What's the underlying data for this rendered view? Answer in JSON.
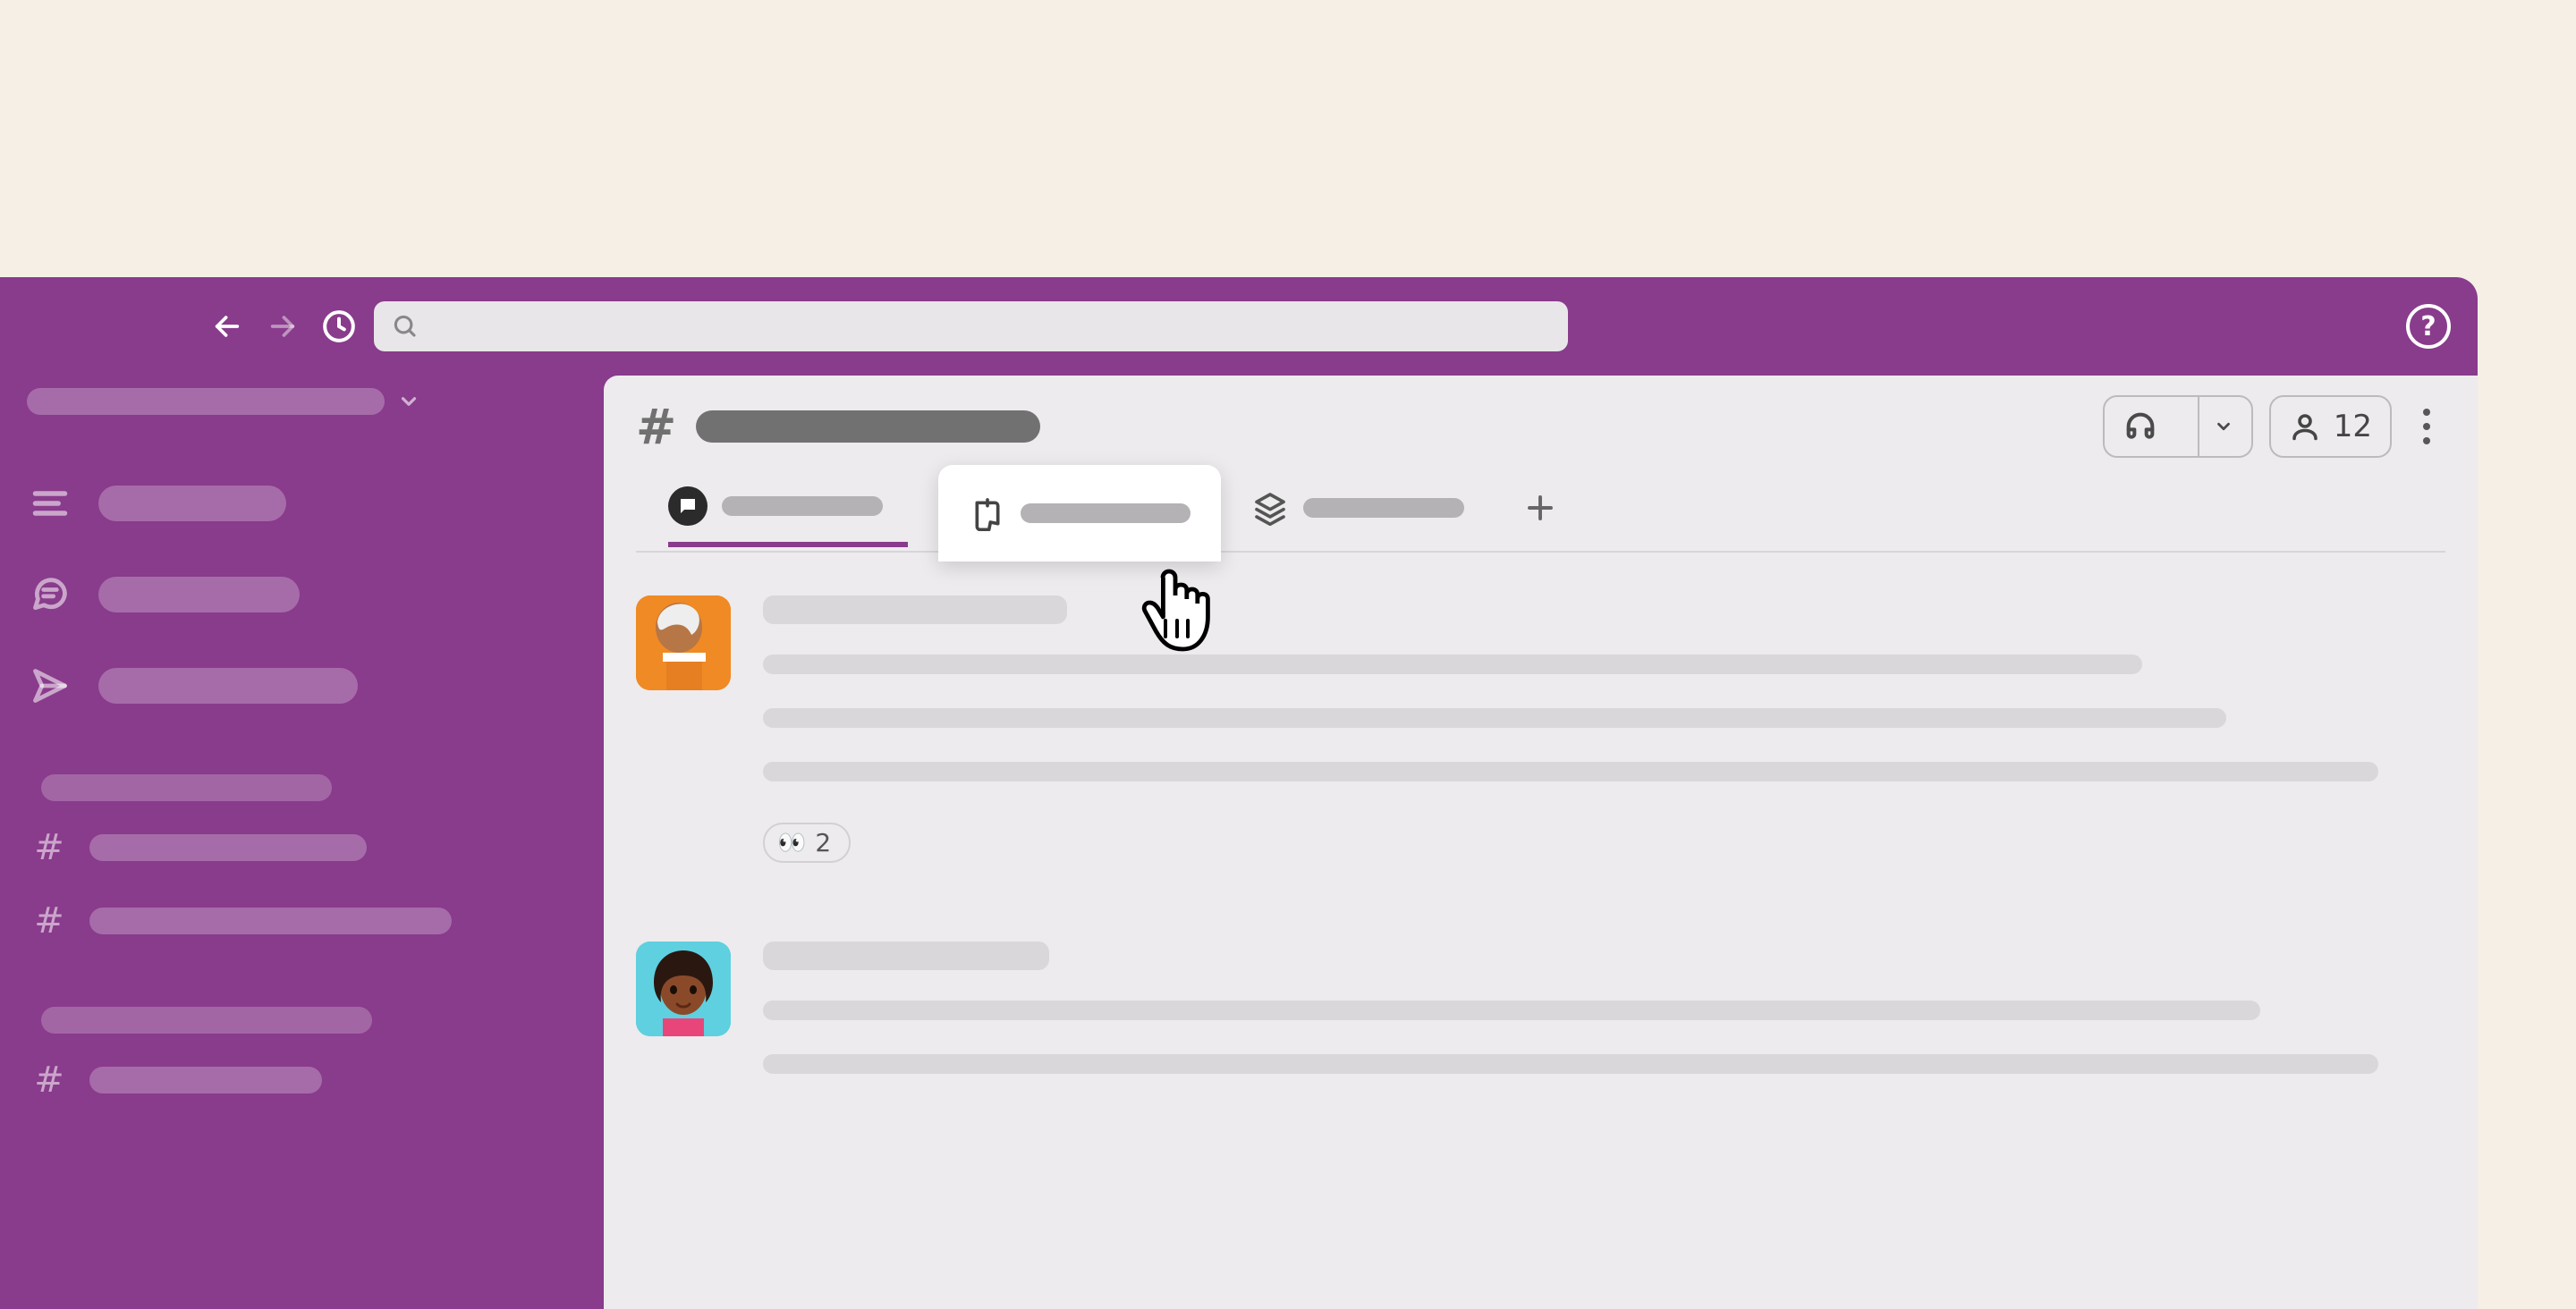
{
  "topbar": {
    "search_placeholder": "",
    "help_label": "?"
  },
  "header": {
    "member_count": "12"
  },
  "tabs": {
    "messages": {
      "icon": "message"
    },
    "canvas": {
      "icon": "canvas"
    },
    "files": {
      "icon": "layers"
    }
  },
  "messages": [
    {
      "reactions": [
        {
          "emoji": "👀",
          "count": "2"
        }
      ]
    },
    {
      "reactions": []
    }
  ]
}
